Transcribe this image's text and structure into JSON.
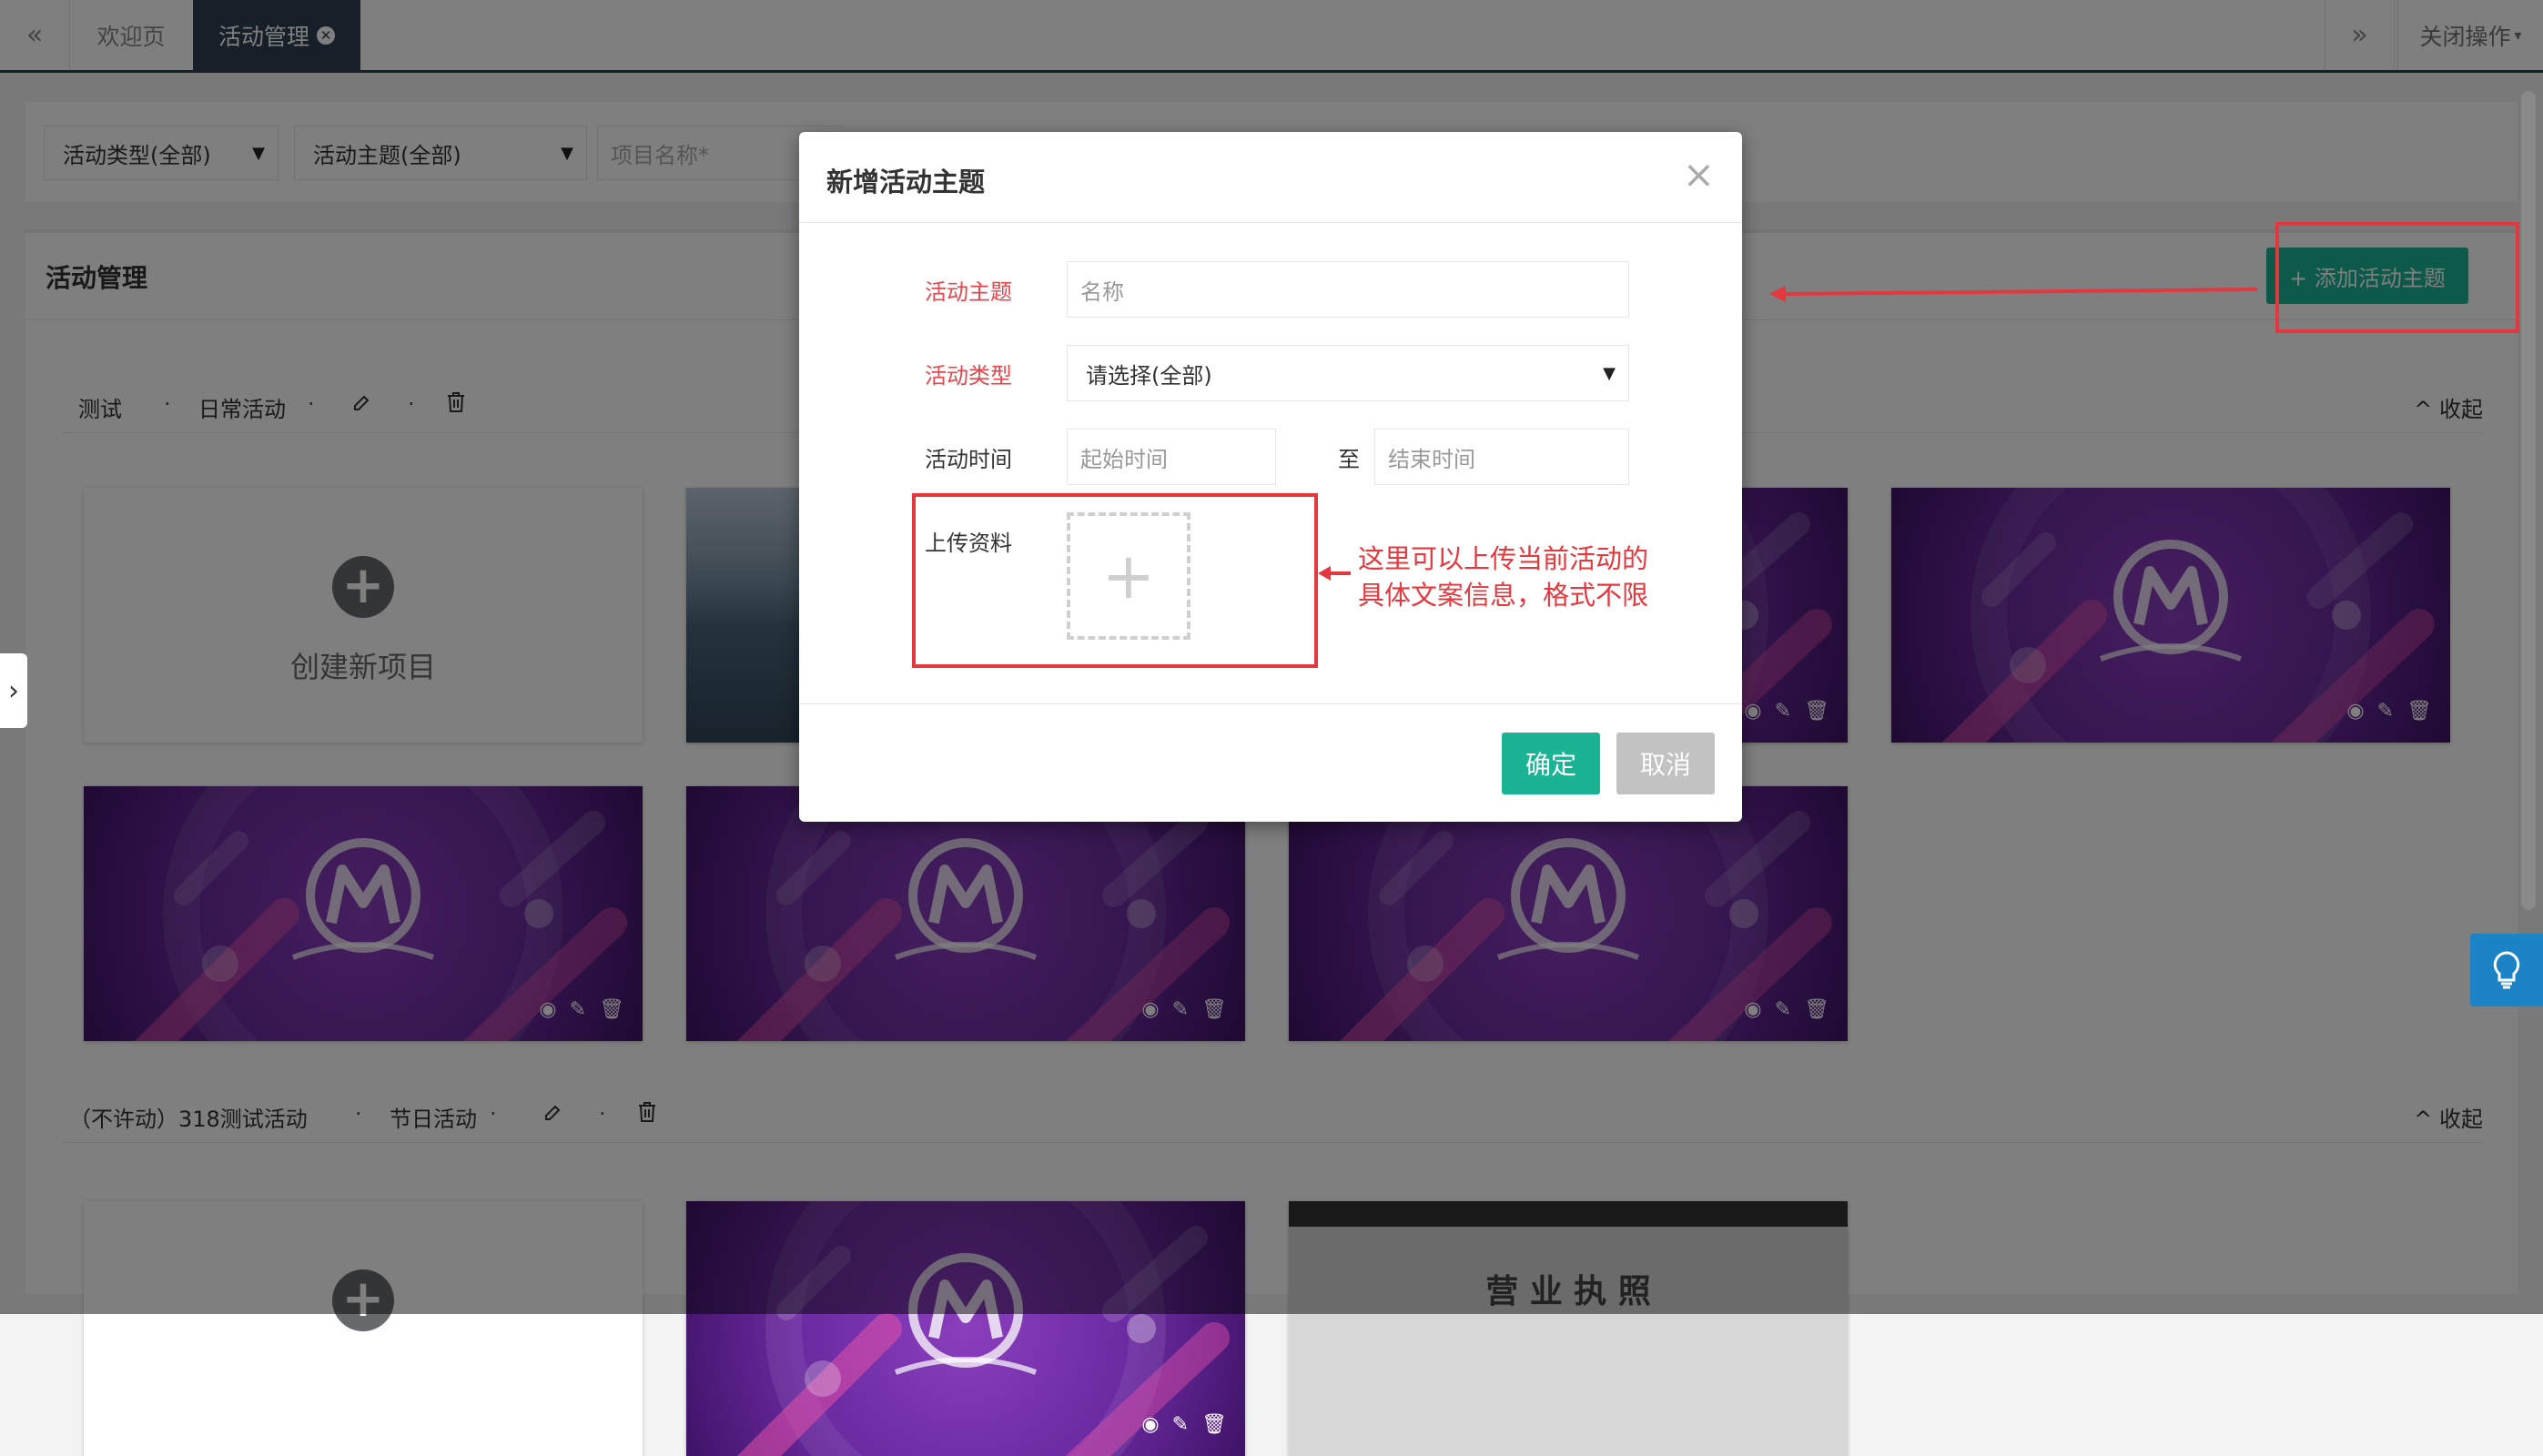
{
  "tabs": {
    "prev_label": "«",
    "next_label": "»",
    "items": [
      {
        "label": "欢迎页"
      },
      {
        "label": "活动管理",
        "close": "✕"
      }
    ],
    "close_ops_label": "关闭操作",
    "close_ops_caret": "▾"
  },
  "filters": {
    "type_select": "活动类型(全部)",
    "theme_select": "活动主题(全部)",
    "name_placeholder": "项目名称*",
    "arrow": "▼"
  },
  "panel": {
    "title": "活动管理",
    "add_button": "+ 添加活动主题"
  },
  "groups": [
    {
      "name": "测试",
      "category": "日常活动",
      "separator": "·",
      "collapse_label": "^ 收起",
      "create_label": "创建新项目"
    },
    {
      "name": "（不许动）318测试活动",
      "category": "节日活动",
      "separator": "·",
      "collapse_label": "^ 收起"
    }
  ],
  "doc_card_text": "营 业 执 照",
  "modal": {
    "title": "新增活动主题",
    "close": "×",
    "fields": {
      "theme_label": "活动主题",
      "theme_placeholder": "名称",
      "type_label": "活动类型",
      "type_value": "请选择(全部)",
      "time_label": "活动时间",
      "start_placeholder": "起始时间",
      "to_label": "至",
      "end_placeholder": "结束时间",
      "upload_label": "上传资料"
    },
    "ok_label": "确定",
    "cancel_label": "取消"
  },
  "annotation": {
    "line1": "这里可以上传当前活动的",
    "line2": "具体文案信息，格式不限"
  },
  "colors": {
    "primary": "#1ab394",
    "nav_dark": "#2f4050",
    "annotation_red": "#e5383e",
    "card_purple": "#6a2aa0",
    "info_blue": "#1c84c6"
  },
  "icons": [
    "double-left-icon",
    "double-right-icon",
    "close-circle-icon",
    "caret-down-icon",
    "plus-icon",
    "edit-icon",
    "trash-icon",
    "eye-icon",
    "chevron-up-icon",
    "chevron-right-icon",
    "lightbulb-icon"
  ]
}
